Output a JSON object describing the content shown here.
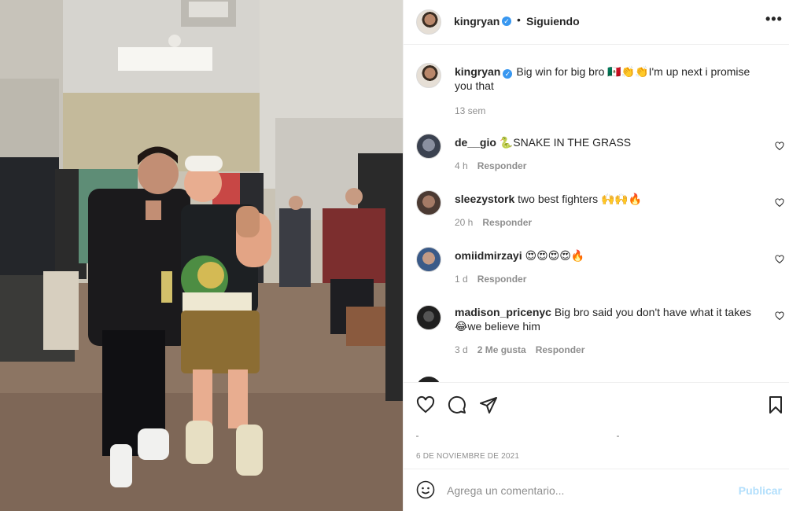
{
  "post": {
    "username": "kingryan",
    "verified_glyph": "✓",
    "separator": "•",
    "follow_status": "Siguiendo",
    "more_label": "•••"
  },
  "caption": {
    "username": "kingryan",
    "text": "Big win for big bro 🇲🇽👏👏I'm up next i promise you that",
    "time": "13 sem"
  },
  "comments": [
    {
      "username": "de__gio",
      "text": "🐍SNAKE IN THE GRASS",
      "time": "4 h",
      "likes": "",
      "reply": "Responder"
    },
    {
      "username": "sleezystork",
      "text": "two best fighters 🙌🙌🔥",
      "time": "20 h",
      "likes": "",
      "reply": "Responder"
    },
    {
      "username": "omiidmirzayi",
      "text": "😍😍😍😍🔥",
      "time": "1 d",
      "likes": "",
      "reply": "Responder"
    },
    {
      "username": "madison_pricenyc",
      "text": "Big bro said you don't have what it takes 😂we believe him",
      "time": "3 d",
      "likes": "2 Me gusta",
      "reply": "Responder"
    }
  ],
  "date": "6 DE NOVIEMBRE DE 2021",
  "add_comment": {
    "placeholder": "Agrega un comentario...",
    "submit": "Publicar"
  },
  "icons": {
    "like": "heart-icon",
    "comment": "comment-icon",
    "share": "share-icon",
    "save": "bookmark-icon",
    "emoji": "emoji-icon",
    "more": "more-icon"
  },
  "colors": {
    "verified": "#3897f0",
    "publish_disabled": "#b2dffc",
    "muted": "#8e8e8e"
  }
}
